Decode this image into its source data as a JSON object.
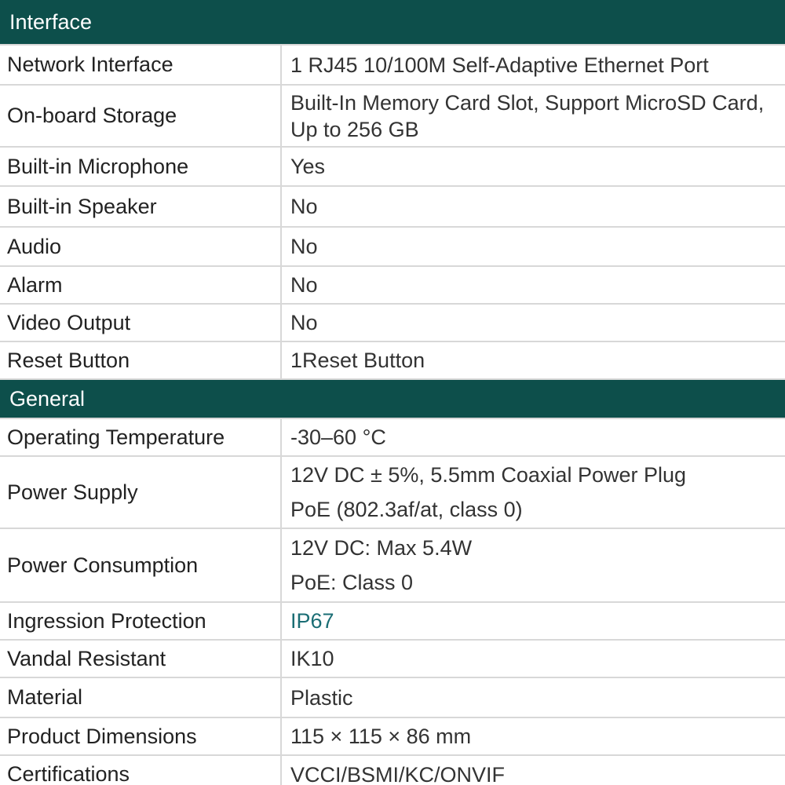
{
  "sections": [
    {
      "title": "Interface",
      "rows": [
        {
          "label": "Network Interface",
          "lines": [
            "1 RJ45 10/100M Self-Adaptive Ethernet Port"
          ]
        },
        {
          "label": "On-board Storage",
          "lines": [
            "Built-In Memory Card Slot, Support MicroSD Card,",
            "Up to 256 GB"
          ]
        },
        {
          "label": "Built-in Microphone",
          "lines": [
            "Yes"
          ]
        },
        {
          "label": "Built-in Speaker",
          "lines": [
            "No"
          ]
        },
        {
          "label": "Audio",
          "lines": [
            "No"
          ]
        },
        {
          "label": "Alarm",
          "lines": [
            "No"
          ]
        },
        {
          "label": "Video Output",
          "lines": [
            "No"
          ]
        },
        {
          "label": "Reset Button",
          "lines": [
            "1Reset Button"
          ]
        }
      ]
    },
    {
      "title": "General",
      "rows": [
        {
          "label": "Operating Temperature",
          "lines": [
            "-30–60 °C"
          ]
        },
        {
          "label": "Power Supply",
          "lines": [
            "12V DC ± 5%, 5.5mm Coaxial Power Plug",
            "PoE (802.3af/at, class 0)"
          ]
        },
        {
          "label": "Power Consumption",
          "lines": [
            "12V DC: Max 5.4W",
            "PoE: Class 0"
          ]
        },
        {
          "label": "Ingression Protection",
          "lines": [
            "IP67"
          ]
        },
        {
          "label": "Vandal Resistant",
          "lines": [
            "IK10"
          ]
        },
        {
          "label": "Material",
          "lines": [
            "Plastic"
          ]
        },
        {
          "label": "Product Dimensions",
          "lines": [
            "115 × 115 × 86 mm"
          ]
        },
        {
          "label": "Certifications",
          "lines": [
            "VCCI/BSMI/KC/ONVIF"
          ]
        }
      ]
    }
  ],
  "colors": {
    "header_bg": "#0d4f4b",
    "accent_text": "#1a6d74",
    "border": "#d8d8d8"
  }
}
